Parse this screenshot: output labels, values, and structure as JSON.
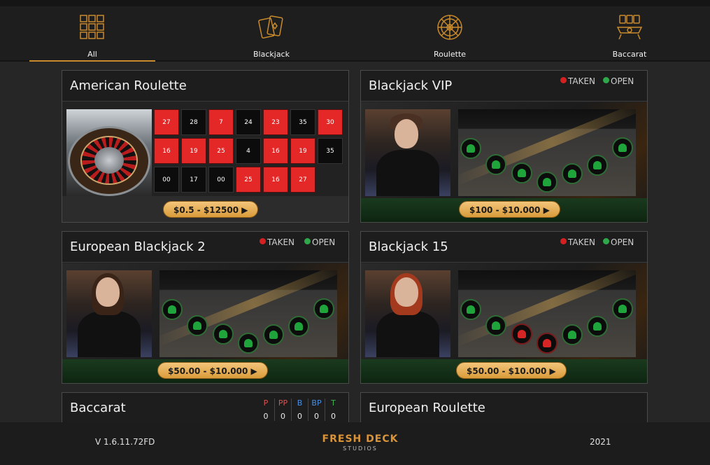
{
  "nav": {
    "items": [
      {
        "label": "All",
        "icon": "grid-icon",
        "active": true
      },
      {
        "label": "Blackjack",
        "icon": "cards-icon",
        "active": false
      },
      {
        "label": "Roulette",
        "icon": "roulette-wheel-icon",
        "active": false
      },
      {
        "label": "Baccarat",
        "icon": "baccarat-table-icon",
        "active": false
      }
    ]
  },
  "legend": {
    "taken": "TAKEN",
    "open": "OPEN"
  },
  "cards": {
    "american_roulette": {
      "title": "American Roulette",
      "price": "$0.5 - $12500 ▶",
      "numbers": [
        [
          "27",
          "28",
          "7",
          "24",
          "23",
          "35",
          "30"
        ],
        [
          "16",
          "19",
          "25",
          "4",
          "16",
          "19",
          "35"
        ],
        [
          "00",
          "17",
          "00",
          "25",
          "16",
          "27"
        ]
      ],
      "colors": [
        [
          "r",
          "b",
          "r",
          "b",
          "r",
          "b",
          "r"
        ],
        [
          "r",
          "r",
          "r",
          "b",
          "r",
          "r",
          "b"
        ],
        [
          "b",
          "b",
          "b",
          "r",
          "r",
          "r"
        ]
      ]
    },
    "blackjack_vip": {
      "title": "Blackjack VIP",
      "price": "$100 - $10.000 ▶",
      "seats": [
        "open",
        "open",
        "open",
        "open",
        "open",
        "open",
        "open"
      ]
    },
    "european_blackjack_2": {
      "title": "European Blackjack 2",
      "price": "$50.00 - $10.000 ▶",
      "seats": [
        "open",
        "open",
        "open",
        "open",
        "open",
        "open",
        "open"
      ]
    },
    "blackjack_15": {
      "title": "Blackjack 15",
      "price": "$50.00 - $10.000 ▶",
      "seats": [
        "open",
        "open",
        "taken",
        "taken",
        "open",
        "open",
        "open"
      ]
    },
    "baccarat": {
      "title": "Baccarat",
      "stats": [
        {
          "label": "P",
          "value": "0",
          "color": "#e05050"
        },
        {
          "label": "PP",
          "value": "0",
          "color": "#e05050"
        },
        {
          "label": "B",
          "value": "0",
          "color": "#4a8fe0"
        },
        {
          "label": "BP",
          "value": "0",
          "color": "#4a8fe0"
        },
        {
          "label": "T",
          "value": "0",
          "color": "#3fb24f"
        }
      ]
    },
    "european_roulette": {
      "title": "European Roulette"
    }
  },
  "footer": {
    "version": "V 1.6.11.72FD",
    "logo_main": "FRESH DECK",
    "logo_sub": "STUDIOS",
    "year": "2021"
  },
  "colors": {
    "accent": "#c98a2b",
    "taken": "#d42020",
    "open": "#2ea84a",
    "roulette_red": "#e42828"
  }
}
